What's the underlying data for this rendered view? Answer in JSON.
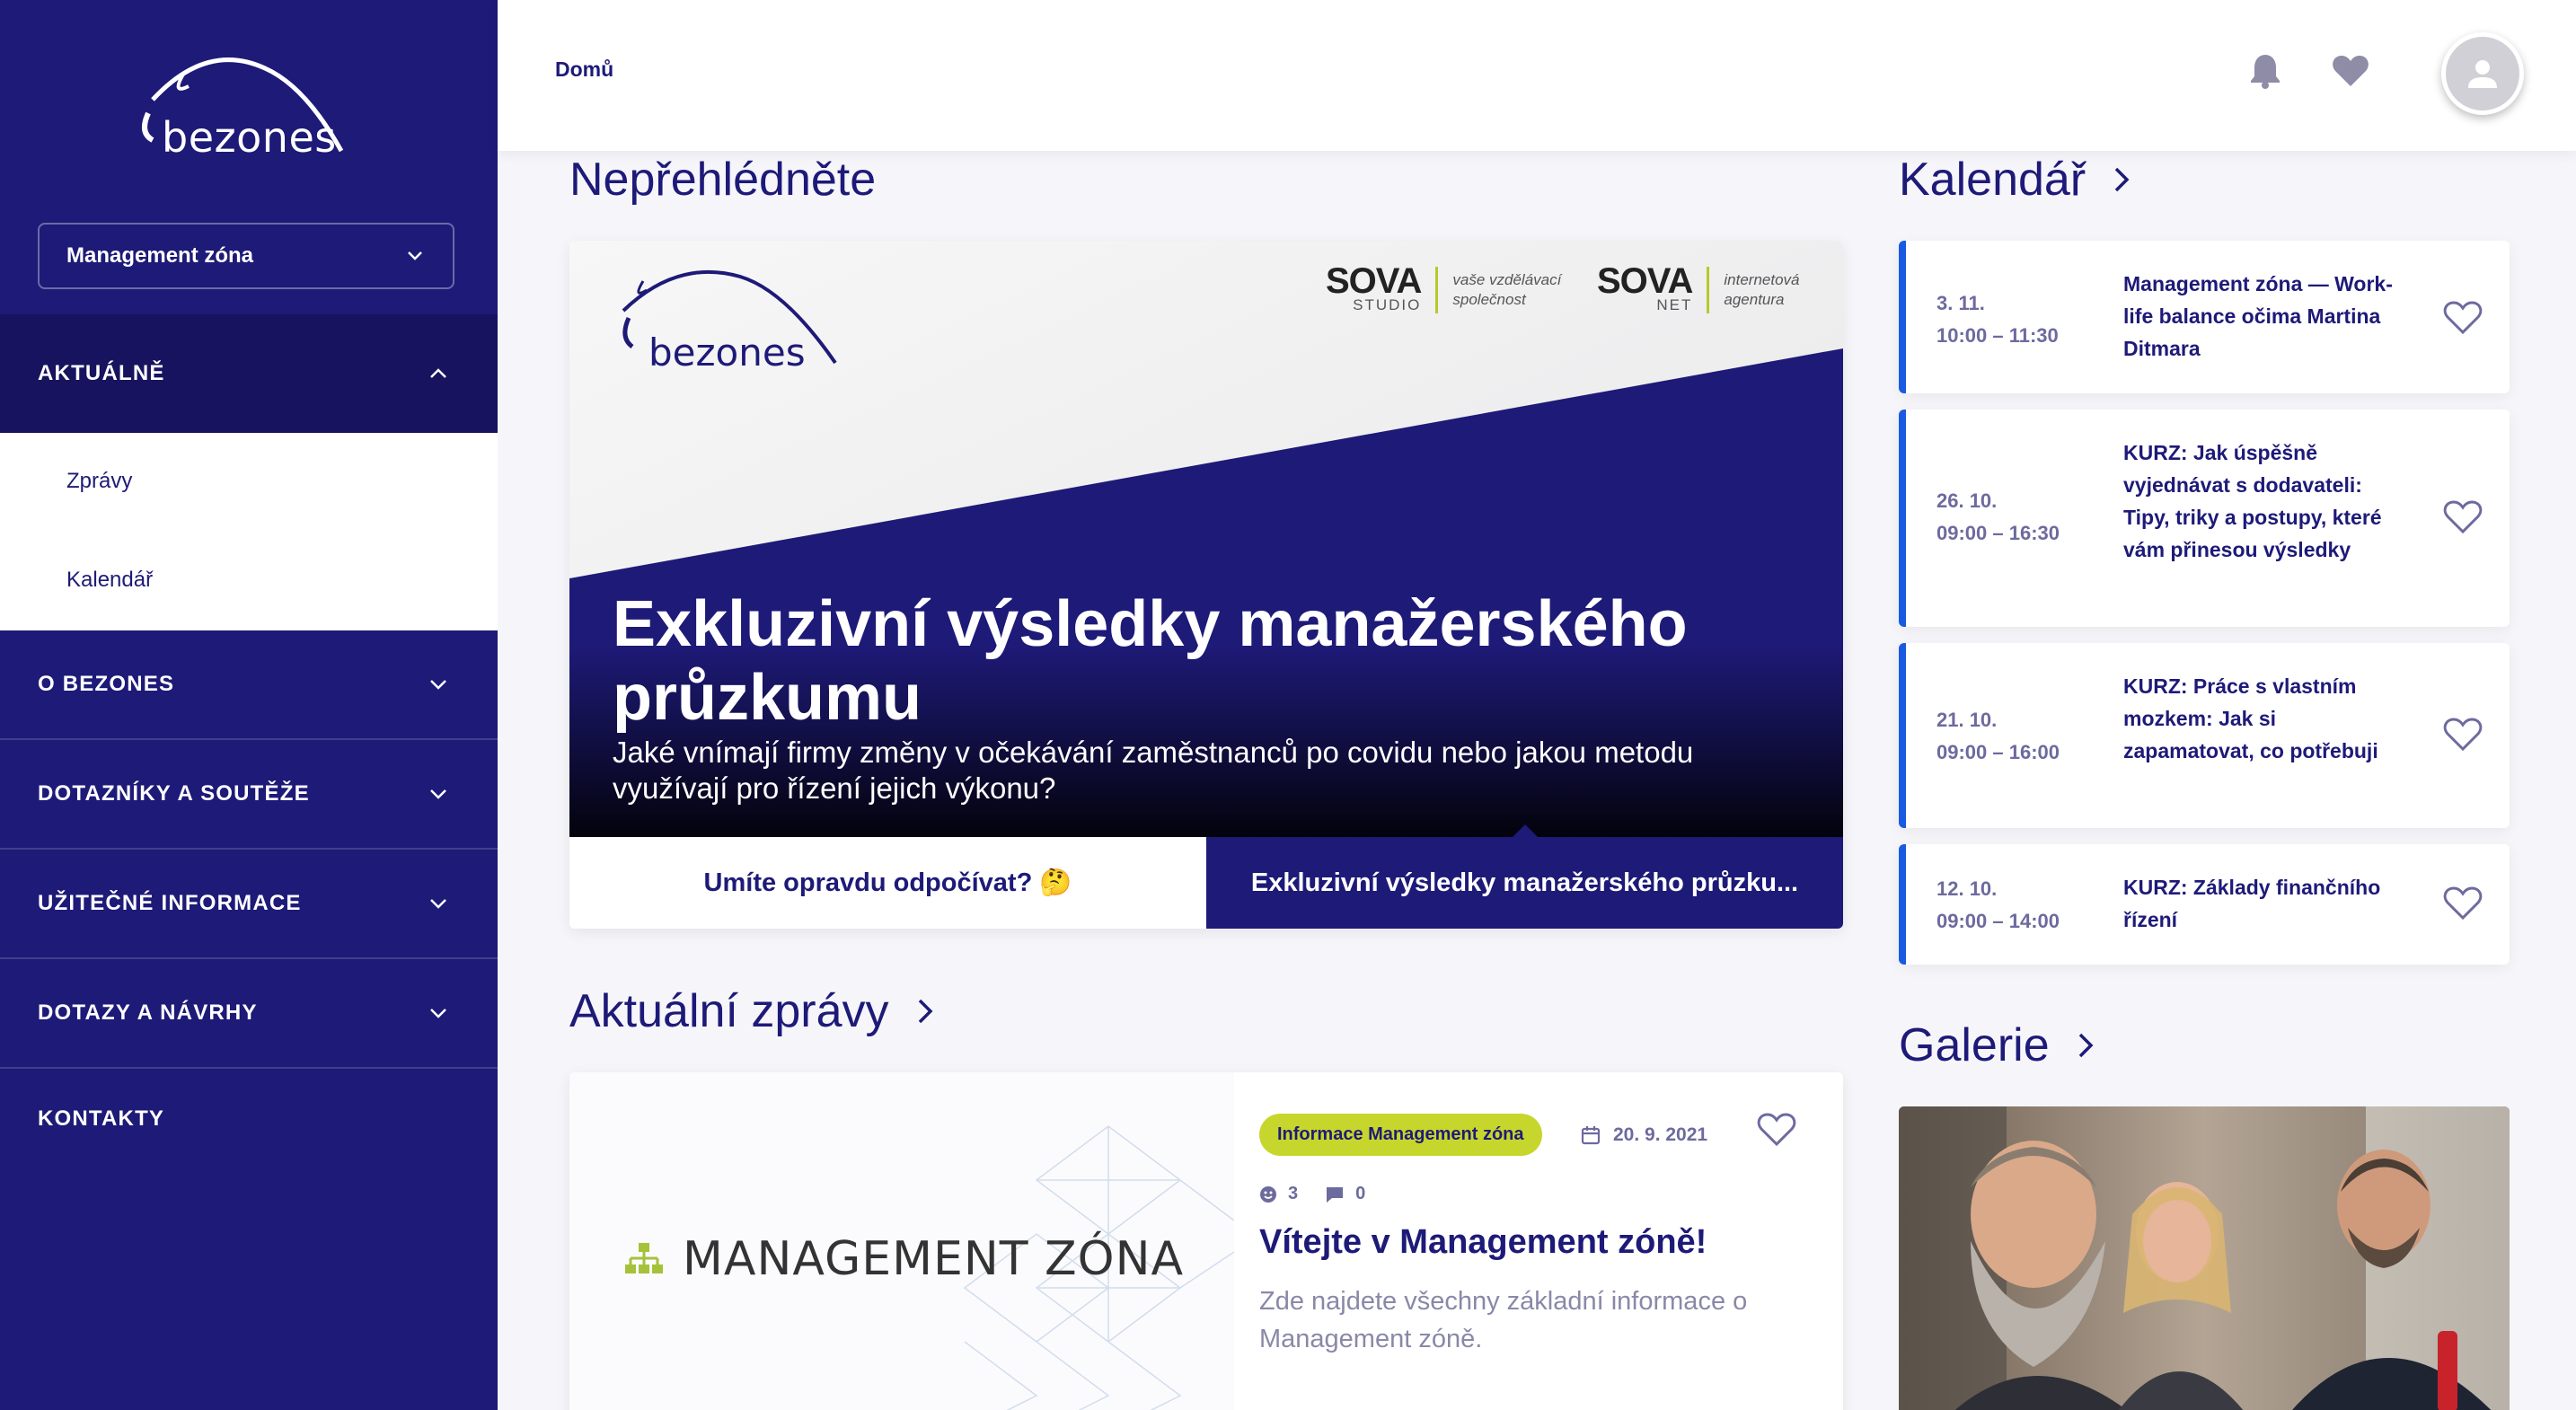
{
  "brand": {
    "logo_text": "bezones"
  },
  "sidebar": {
    "zone_select": "Management zóna",
    "sections": [
      {
        "label": "AKTUÁLNĚ",
        "expanded": true,
        "items": [
          {
            "label": "Zprávy"
          },
          {
            "label": "Kalendář"
          }
        ]
      },
      {
        "label": "O BEZONES"
      },
      {
        "label": "DOTAZNÍKY A SOUTĚŽE"
      },
      {
        "label": "UŽITEČNÉ INFORMACE"
      },
      {
        "label": "DOTAZY A NÁVRHY"
      },
      {
        "label": "KONTAKTY"
      }
    ]
  },
  "header": {
    "breadcrumb": "Domů",
    "icons": [
      "bell-icon",
      "heart-icon",
      "user-icon"
    ]
  },
  "featured": {
    "section_title": "Nepřehlédněte",
    "sponsor1": {
      "name": "SOVA",
      "sub": "STUDIO",
      "tagline_1": "vaše vzdělávací",
      "tagline_2": "společnost"
    },
    "sponsor2": {
      "name": "SOVA",
      "sub": "NET",
      "tagline_1": "internetová",
      "tagline_2": "agentura"
    },
    "title": "Exkluzivní výsledky manažerského průzkumu",
    "subtitle": "Jaké vnímají firmy změny v očekávání zaměstnanců po covidu nebo jakou metodu využívají pro řízení jejich výkonu?",
    "tabs": [
      {
        "label": "Umíte opravdu odpočívat? 🤔",
        "active": false
      },
      {
        "label": "Exkluzivní výsledky manažerského průzku...",
        "active": true
      }
    ]
  },
  "news": {
    "section_title": "Aktuální zprávy",
    "image_text": "MANAGEMENT ZÓNA",
    "tag": "Informace Management zóna",
    "date": "20. 9. 2021",
    "reactions": "3",
    "comments": "0",
    "title": "Vítejte v Management zóně!",
    "text": "Zde najdete všechny základní informace o Management zóně."
  },
  "calendar": {
    "section_title": "Kalendář",
    "events": [
      {
        "date": "3. 11.",
        "time": "10:00 – 11:30",
        "title": "Management zóna — Work-life balance očima Martina Ditmara"
      },
      {
        "date": "26. 10.",
        "time": "09:00 – 16:30",
        "title": "KURZ: Jak úspěšně vyjednávat s dodavateli: Tipy, triky a postupy, které vám přinesou výsledky"
      },
      {
        "date": "21. 10.",
        "time": "09:00 – 16:00",
        "title": "KURZ: Práce s vlastním mozkem: Jak si zapamatovat, co potřebuji"
      },
      {
        "date": "12. 10.",
        "time": "09:00 – 14:00",
        "title": "KURZ: Základy finančního řízení"
      }
    ]
  },
  "gallery": {
    "section_title": "Galerie"
  },
  "colors": {
    "primary": "#1e1a78",
    "accent_blue": "#1a5ae0",
    "tag_green": "#c6d62c",
    "background": "#f6f6fa"
  }
}
